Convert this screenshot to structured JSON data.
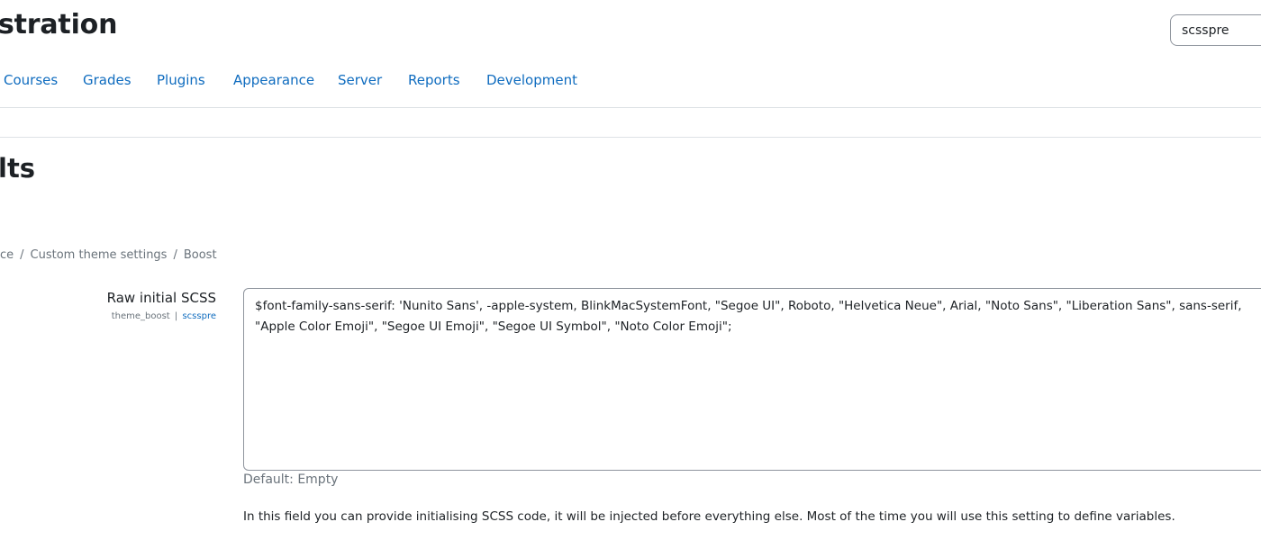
{
  "header": {
    "title": "stration",
    "search": {
      "value": "scsspre",
      "placeholder": ""
    }
  },
  "nav": {
    "tabs": [
      {
        "label": "Courses"
      },
      {
        "label": "Grades"
      },
      {
        "label": "Plugins"
      },
      {
        "label": "Appearance"
      },
      {
        "label": "Server"
      },
      {
        "label": "Reports"
      },
      {
        "label": "Development"
      }
    ]
  },
  "section": {
    "heading": "lts"
  },
  "breadcrumb": {
    "items": [
      "ce",
      "Custom theme settings",
      "Boost"
    ],
    "separator": "/"
  },
  "setting": {
    "label": "Raw initial SCSS",
    "component": "theme_boost",
    "separator": "|",
    "key": "scsspre",
    "value": "$font-family-sans-serif: 'Nunito Sans', -apple-system, BlinkMacSystemFont, \"Segoe UI\", Roboto, \"Helvetica Neue\", Arial, \"Noto Sans\", \"Liberation Sans\", sans-serif, \"Apple Color Emoji\", \"Segoe UI Emoji\", \"Segoe UI Symbol\", \"Noto Color Emoji\";",
    "default_text": "Default: Empty",
    "description": "In this field you can provide initialising SCSS code, it will be injected before everything else. Most of the time you will use this setting to define variables."
  },
  "colors": {
    "link": "#0f6cbf",
    "text": "#1d2125",
    "muted": "#6a737b",
    "border": "#8f959e",
    "divider": "#dee2e6"
  }
}
